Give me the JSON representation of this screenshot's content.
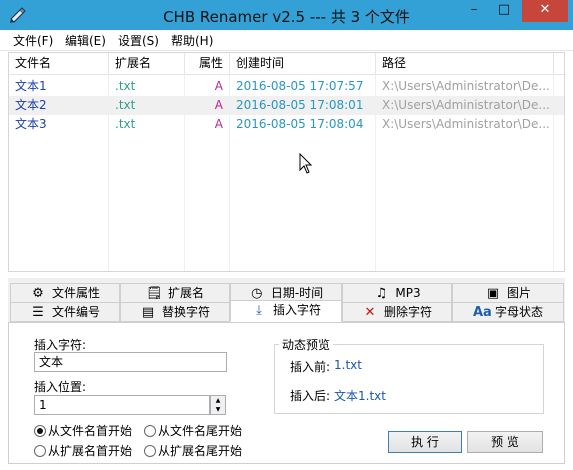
{
  "window": {
    "title": "CHB Renamer v2.5 --- 共 3 个文件",
    "min_glyph": "–",
    "max_glyph": "□",
    "close_glyph": "✕"
  },
  "menu": [
    "文件(F)",
    "编辑(E)",
    "设置(S)",
    "帮助(H)"
  ],
  "list": {
    "columns": [
      "文件名",
      "扩展名",
      "属性",
      "创建时间",
      "路径"
    ],
    "rows": [
      {
        "name": "文本1",
        "ext": ".txt",
        "attr": "A",
        "created": "2016-08-05 17:07:57",
        "path": "X:\\Users\\Administrator\\De..."
      },
      {
        "name": "文本2",
        "ext": ".txt",
        "attr": "A",
        "created": "2016-08-05 17:08:01",
        "path": "X:\\Users\\Administrator\\De..."
      },
      {
        "name": "文本3",
        "ext": ".txt",
        "attr": "A",
        "created": "2016-08-05 17:08:04",
        "path": "X:\\Users\\Administrator\\De..."
      }
    ]
  },
  "tabs_top": [
    {
      "label": "文件属性",
      "icon": "gear-icon"
    },
    {
      "label": "扩展名",
      "icon": "document-icon"
    },
    {
      "label": "日期-时间",
      "icon": "clock-icon"
    },
    {
      "label": "MP3",
      "icon": "music-file-icon"
    },
    {
      "label": "图片",
      "icon": "image-icon"
    }
  ],
  "tabs_bottom": [
    {
      "label": "文件编号",
      "icon": "numbered-list-icon"
    },
    {
      "label": "替换字符",
      "icon": "replace-icon"
    },
    {
      "label": "插入字符",
      "icon": "insert-arrow-icon"
    },
    {
      "label": "删除字符",
      "icon": "delete-x-icon"
    },
    {
      "label": "字母状态",
      "icon": "letter-case-icon"
    }
  ],
  "insert": {
    "char_label": "插入字符:",
    "char_value": "文本",
    "pos_label": "插入位置:",
    "pos_value": "1",
    "radios": [
      {
        "label": "从文件名首开始",
        "checked": true
      },
      {
        "label": "从文件名尾开始",
        "checked": false
      },
      {
        "label": "从扩展名首开始",
        "checked": false
      },
      {
        "label": "从扩展名尾开始",
        "checked": false
      }
    ]
  },
  "preview": {
    "title": "动态预览",
    "before_label": "插入前:",
    "before_value": "1.txt",
    "after_label": "插入后:",
    "after_value": "文本1.txt"
  },
  "buttons": {
    "execute": "执 行",
    "preview": "预 览"
  },
  "colors": {
    "titlebar": "#33a0d6",
    "close": "#c7463c",
    "name_text": "#1a3fb0",
    "ext_text": "#2f9f8a",
    "attr_text": "#c0248f",
    "created_text": "#2996c3",
    "path_text": "#a0a0a0"
  }
}
